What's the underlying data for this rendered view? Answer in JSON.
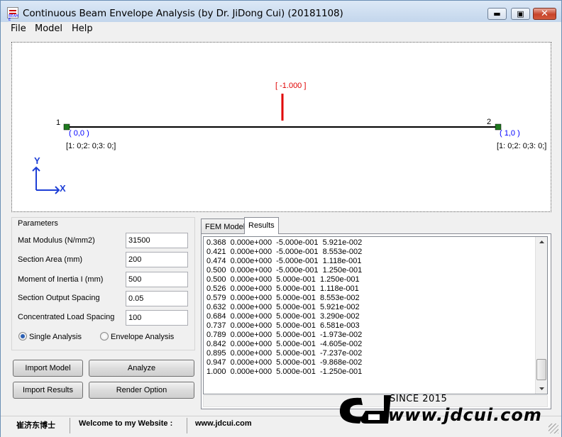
{
  "window": {
    "title": "Continuous Beam Envelope Analysis (by Dr. JiDong Cui) (20181108)",
    "icon_text": "BEAM E",
    "controls": {
      "minimize": "▬",
      "maximize": "▣",
      "close": "✕"
    }
  },
  "menu": {
    "items": [
      "File",
      "Model",
      "Help"
    ]
  },
  "canvas": {
    "load_label": "[ -1.000 ]",
    "node1": {
      "id": "1",
      "coord": "( 0,0 )",
      "dofs": "[1: 0;2: 0;3: 0;]"
    },
    "node2": {
      "id": "2",
      "coord": "( 1,0 )",
      "dofs": "[1: 0;2: 0;3: 0;]"
    },
    "axes": {
      "y": "Y",
      "x": "X"
    },
    "colors": {
      "load": "#e00000",
      "coord": "#0000ff",
      "node": "#1e7a1e",
      "axis": "#1e3fd6"
    }
  },
  "parameters": {
    "title": "Parameters",
    "fields": [
      {
        "label": "Mat Modulus (N/mm2)",
        "value": "31500"
      },
      {
        "label": "Section Area  (mm)",
        "value": "200"
      },
      {
        "label": "Moment of Inertia I (mm)",
        "value": "500"
      },
      {
        "label": "Section Output Spacing",
        "value": "0.05"
      },
      {
        "label": "Concentrated Load Spacing",
        "value": "100"
      }
    ],
    "radios": [
      {
        "label": "Single Analysis",
        "checked": true
      },
      {
        "label": "Envelope Analysis",
        "checked": false
      }
    ]
  },
  "buttons": {
    "import_model": "Import Model",
    "analyze": "Analyze",
    "import_results": "Import Results",
    "render_option": "Render Option"
  },
  "tabs": [
    {
      "label": "FEM Model",
      "active": false
    },
    {
      "label": "Results",
      "active": true
    }
  ],
  "results": {
    "rows": [
      "0.368  0.000e+000  -5.000e-001  5.921e-002",
      "0.421  0.000e+000  -5.000e-001  8.553e-002",
      "0.474  0.000e+000  -5.000e-001  1.118e-001",
      "0.500  0.000e+000  -5.000e-001  1.250e-001",
      "0.500  0.000e+000  5.000e-001  1.250e-001",
      "0.526  0.000e+000  5.000e-001  1.118e-001",
      "0.579  0.000e+000  5.000e-001  8.553e-002",
      "0.632  0.000e+000  5.000e-001  5.921e-002",
      "0.684  0.000e+000  5.000e-001  3.290e-002",
      "0.737  0.000e+000  5.000e-001  6.581e-003",
      "0.789  0.000e+000  5.000e-001  -1.973e-002",
      "0.842  0.000e+000  5.000e-001  -4.605e-002",
      "0.895  0.000e+000  5.000e-001  -7.237e-002",
      "0.947  0.000e+000  5.000e-001  -9.868e-002",
      "1.000  0.000e+000  5.000e-001  -1.250e-001"
    ]
  },
  "statusbar": {
    "name": "崔济东博士",
    "welcome": "Welcome to my Website :",
    "url": "www.jdcui.com"
  },
  "watermark": {
    "since": "SINCE 2015",
    "url": "www.jdcui.com"
  }
}
